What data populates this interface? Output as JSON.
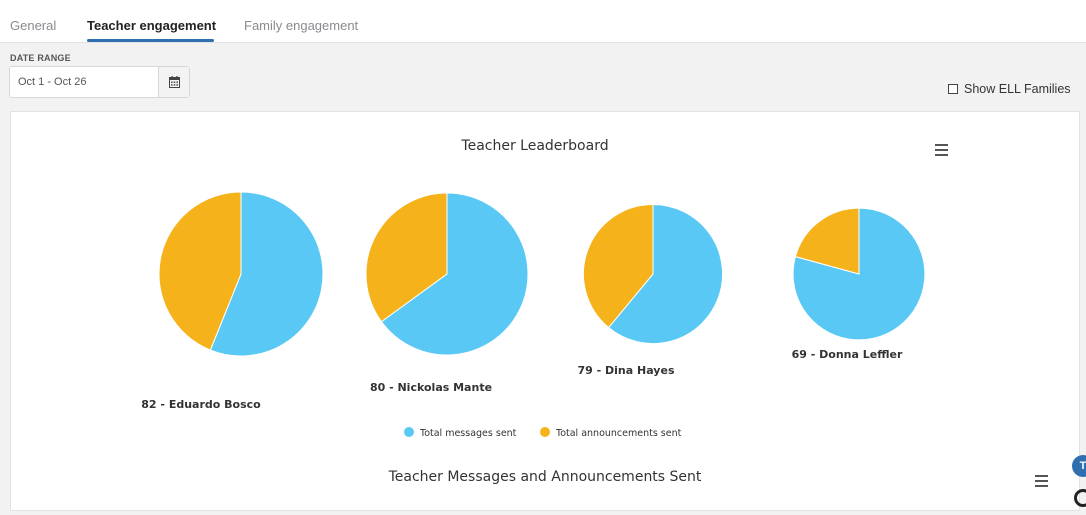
{
  "tabs": [
    {
      "label": "General"
    },
    {
      "label": "Teacher engagement"
    },
    {
      "label": "Family engagement"
    }
  ],
  "filters": {
    "date_range_label": "DATE RANGE",
    "date_range_value": "Oct 1 - Oct 26",
    "ell_label": "Show ELL Families"
  },
  "icons": {
    "calendar": "calendar-icon",
    "menu": "hamburger-menu-icon"
  },
  "colors": {
    "messages": "#5ac8f5",
    "announcements": "#f6b21b",
    "accent": "#2f6fb0"
  },
  "chart_data": {
    "type": "pie",
    "title": "Teacher Leaderboard",
    "labels": [
      "82 - Eduardo Bosco",
      "80 - Nickolas Mante",
      "79 - Dina Hayes",
      "69 - Donna Leffler"
    ],
    "series": [
      {
        "name": "Total messages sent",
        "values": [
          46,
          52,
          36,
          42
        ]
      },
      {
        "name": "Total announcements sent",
        "values": [
          36,
          28,
          23,
          11
        ]
      }
    ],
    "legend": "bottom-center"
  },
  "second_chart": {
    "title": "Teacher Messages and Announcements Sent"
  }
}
